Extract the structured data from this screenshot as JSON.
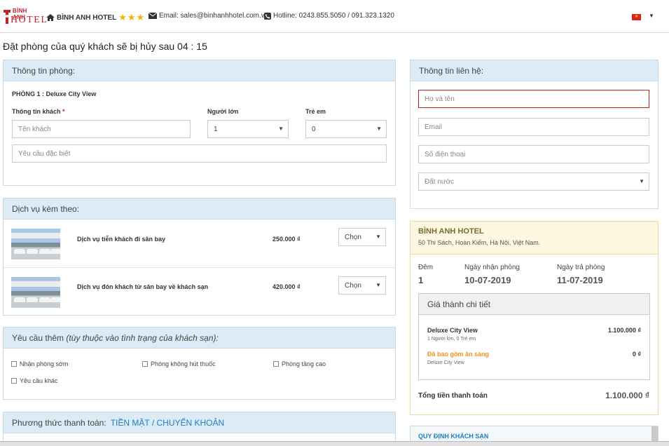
{
  "header": {
    "logo_line1": "BÌNH ANH",
    "logo_line2": "HOTEL",
    "hotel_name": "BÌNH ANH HOTEL",
    "stars": "★★★",
    "email": "Email: sales@binhanhhotel.com.vn",
    "hotline": "Hotline: 0243.855.5050 / 091.323.1320",
    "language": "vi",
    "colors": {
      "brand_red": "#c0242b",
      "star": "#f0b400",
      "panel_blue": "#dcebf5",
      "link_blue": "#1f7fc1"
    }
  },
  "countdown": {
    "text": "Đặt phòng của quý khách sẽ bị hủy sau 04 : 15"
  },
  "room_info": {
    "title": "Thông tin phòng:",
    "room_label": "PHÒNG 1 : Deluxe City View",
    "guest_label": "Thông tin khách",
    "required_mark": "*",
    "adults_label": "Người lớn",
    "children_label": "Trẻ em",
    "guest_name_placeholder": "Tên khách",
    "adults_value": "1",
    "children_value": "0",
    "special_request_placeholder": "Yêu cầu đặc biệt"
  },
  "services": {
    "title": "Dịch vụ kèm theo:",
    "items": [
      {
        "name": "Dịch vụ tiễn khách đi sân bay",
        "price": "250.000 ₫",
        "select": "Chọn"
      },
      {
        "name": "Dịch vụ đón khách từ sân bay về khách sạn",
        "price": "420.000 ₫",
        "select": "Chọn"
      }
    ]
  },
  "requests": {
    "title_main": "Yêu cầu thêm",
    "title_note": "(tùy thuộc vào tình trạng của khách sạn):",
    "options": [
      "Nhận phòng sớm",
      "Phòng không hút thuốc",
      "Phòng tầng cao",
      "Yêu cầu khác"
    ]
  },
  "payment": {
    "title": "Phương thức thanh toán:",
    "method": "TIỀN MẶT / CHUYỂN KHOẢN"
  },
  "contact": {
    "title": "Thông tin liên hệ:",
    "name_placeholder": "Họ và tên",
    "email_placeholder": "Email",
    "phone_placeholder": "Số điện thoại",
    "country_placeholder": "Đất nước"
  },
  "summary": {
    "hotel": "BÌNH ANH HOTEL",
    "address": "50 Thi Sách, Hoàn Kiếm, Hà Nội, Việt Nam.",
    "nights_label": "Đêm",
    "nights": "1",
    "checkin_label": "Ngày nhận phòng",
    "checkin": "10-07-2019",
    "checkout_label": "Ngày trả phòng",
    "checkout": "11-07-2019",
    "detail_title": "Giá thành chi tiết",
    "room_name": "Deluxe City View",
    "room_guests": "1 Người lớn, 0 Trẻ em",
    "room_price": "1.100.000 ₫",
    "breakfast": "Đã bao gồm ăn sáng",
    "breakfast_room": "Deluxe City View",
    "breakfast_price": "0 ₫",
    "total_label": "Tổng tiền thanh toán",
    "total": "1.100.000 ₫"
  },
  "policy": {
    "title": "QUY ĐỊNH KHÁCH SẠN"
  }
}
